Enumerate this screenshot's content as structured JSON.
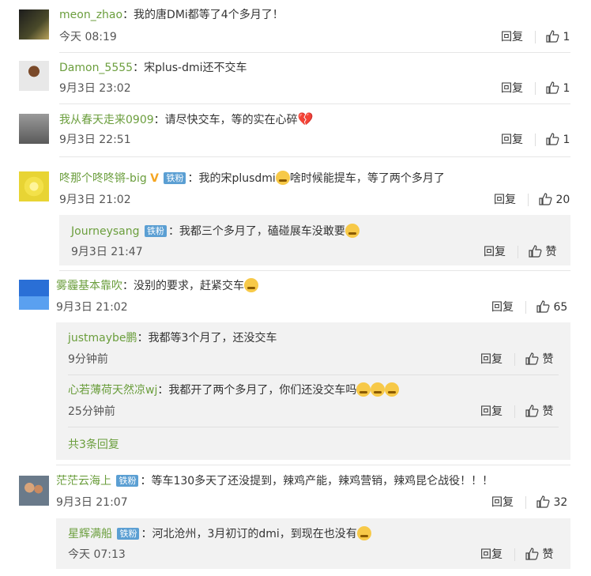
{
  "reply_label": "回复",
  "like_label": "赞",
  "fan_badge": "铁粉",
  "comments": [
    {
      "user": "meon_zhao",
      "text": "：我的唐DMi都等了4个多月了！",
      "time": "今天 08:19",
      "likes": "1"
    },
    {
      "user": "Damon_5555",
      "text": "：宋plus-dmi还不交车",
      "time": "9月3日 23:02",
      "likes": "1"
    },
    {
      "user": "我从春天走来0909",
      "text": "：请尽快交车，等的实在心碎",
      "time": "9月3日 22:51",
      "likes": "1"
    },
    {
      "user": "咚那个咚咚锵-big",
      "text": "：我的宋plusdmi",
      "text2": "啥时候能提车，等了两个多月了",
      "time": "9月3日 21:02",
      "likes": "20"
    },
    {
      "user": "雾霾基本靠吹",
      "text": "：没别的要求，赶紧交车",
      "time": "9月3日 21:02",
      "likes": "65"
    },
    {
      "user": "茫茫云海上",
      "text": "：等车130多天了还没提到，辣鸡产能，辣鸡营销，辣鸡昆仑战役！！！",
      "time": "9月3日 21:07",
      "likes": "32"
    }
  ],
  "replies": [
    {
      "user": "Journeysang",
      "text": "：我都三个多月了，磕碰展车没敢要",
      "time": "9月3日 21:47"
    },
    {
      "user": "justmaybe鹏",
      "text": "：我都等3个月了，还没交车",
      "time": "9分钟前"
    },
    {
      "user": "心若薄荷天然凉wj",
      "text": "：我都开了两个多月了，你们还没交车吗",
      "time": "25分钟前"
    },
    {
      "user": "星辉满船",
      "text": "：河北沧州，3月初订的dmi，到现在也没有",
      "time": "今天 07:13"
    }
  ],
  "more_replies": "共3条回复",
  "colors": {
    "username": "#6b9e3d",
    "badge": "#5b9fd3",
    "reply_bg": "#f2f2f2"
  }
}
